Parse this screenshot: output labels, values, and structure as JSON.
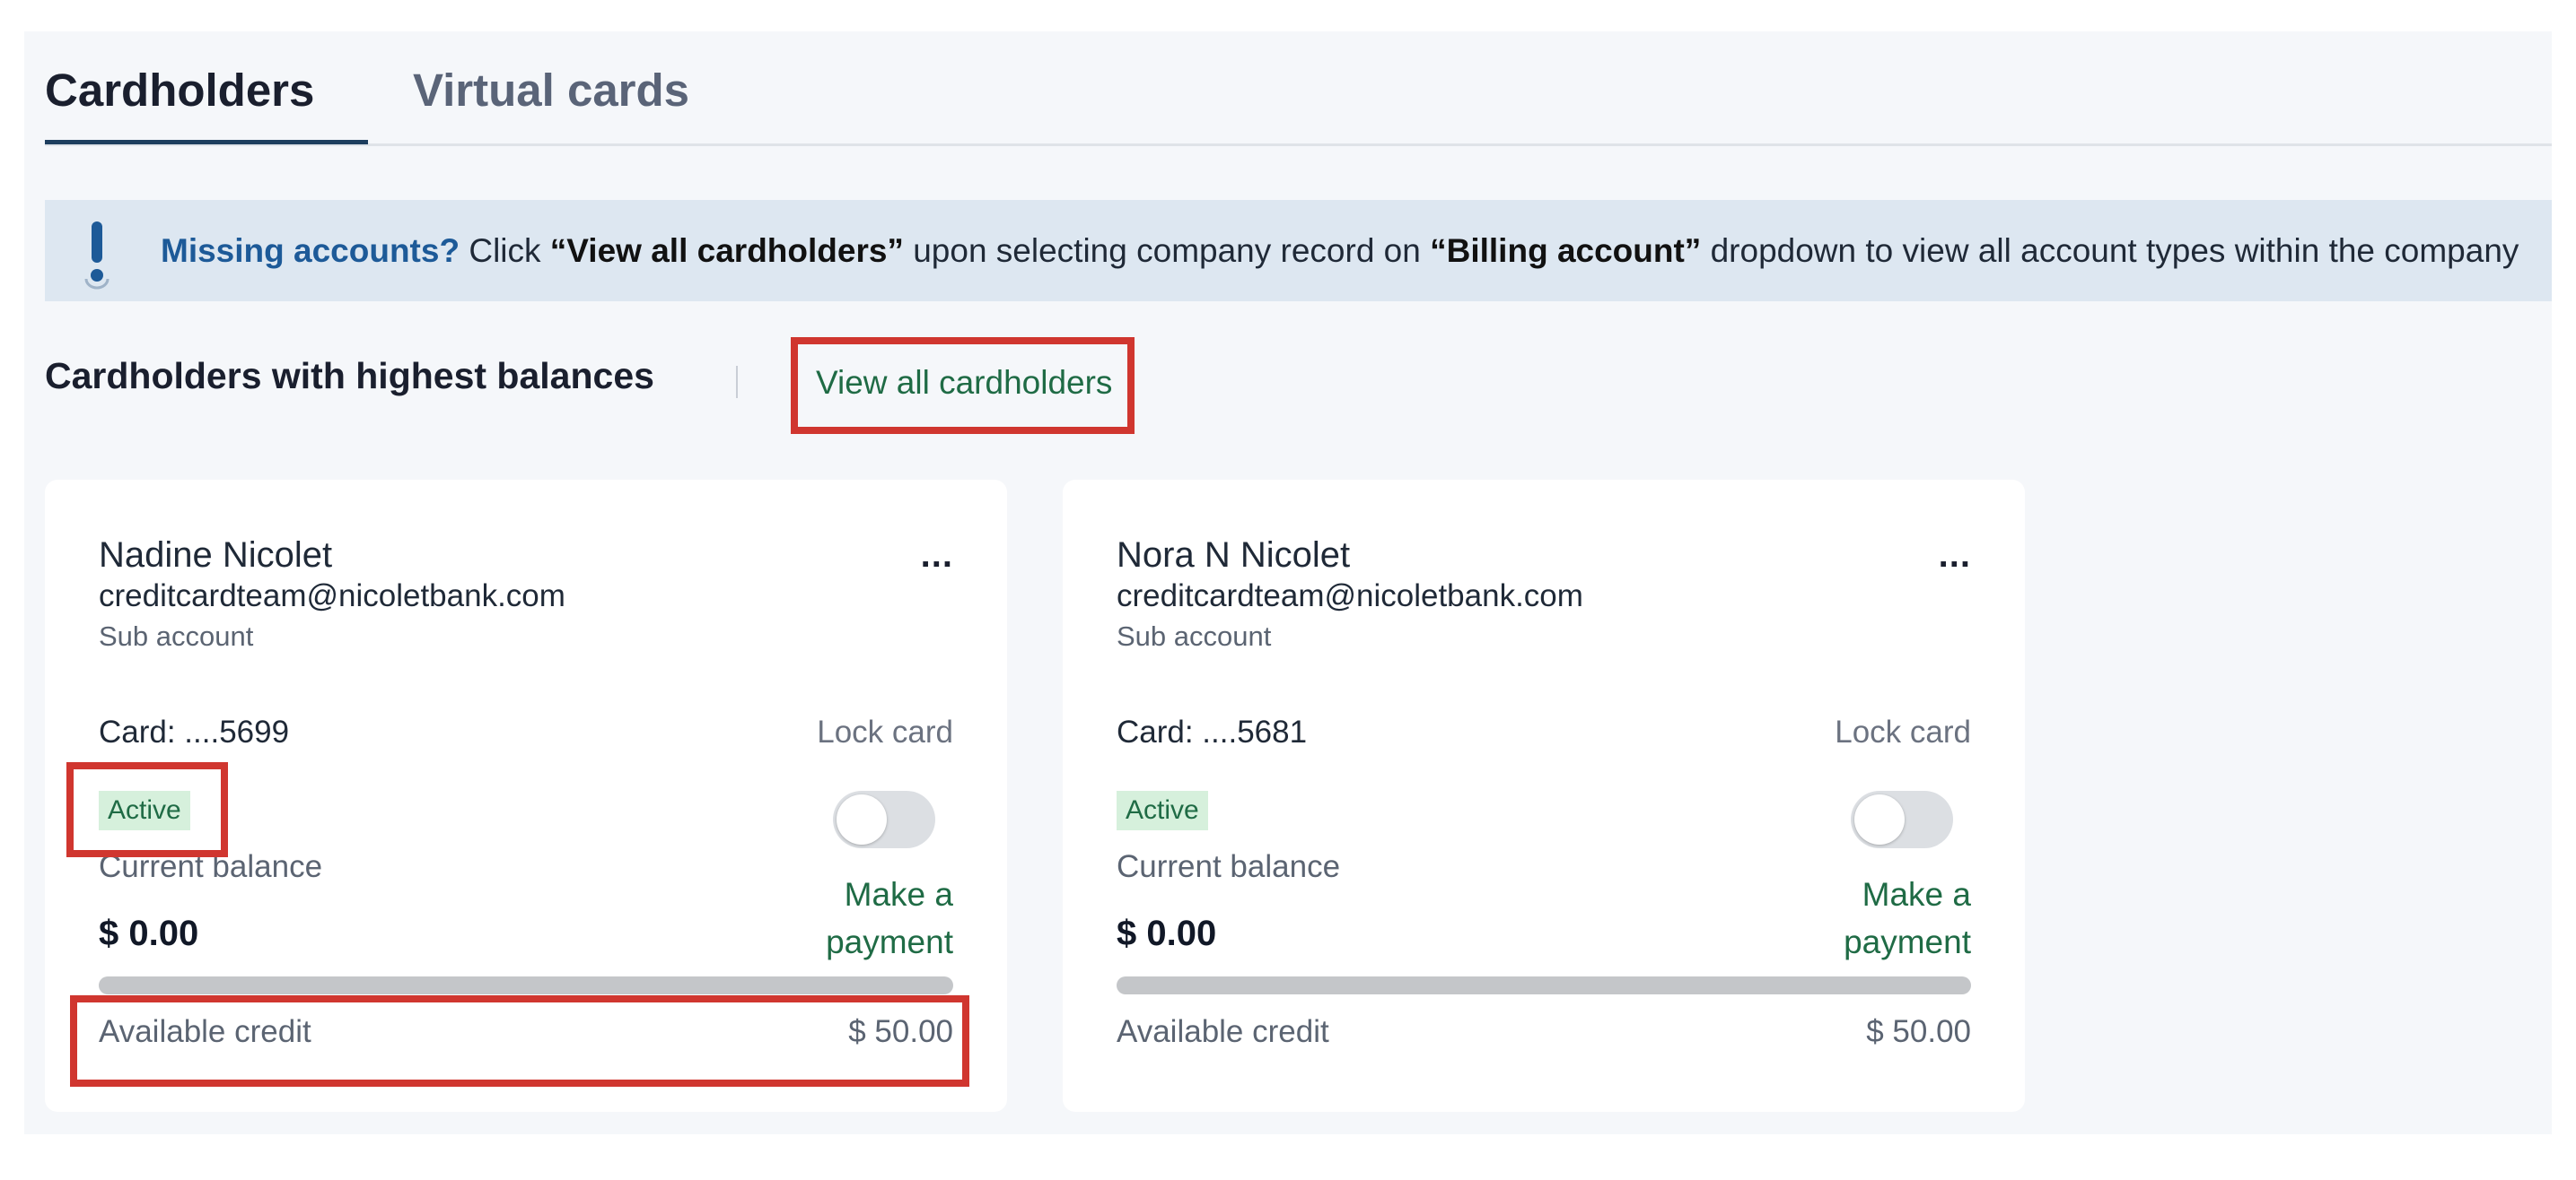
{
  "tabs": [
    {
      "label": "Cardholders",
      "active": true
    },
    {
      "label": "Virtual cards",
      "active": false
    }
  ],
  "banner": {
    "icon": "exclamation-icon",
    "lead": "Missing accounts?",
    "text_1": " Click ",
    "bold_1": "“View all cardholders”",
    "text_2": " upon selecting company record on ",
    "bold_2": "“Billing account”",
    "text_3": " dropdown to view all account types within the company"
  },
  "section": {
    "title": "Cardholders with highest balances",
    "view_all_label": "View all cardholders"
  },
  "cards": [
    {
      "name": "Nadine Nicolet",
      "email": "creditcardteam@nicoletbank.com",
      "account_type": "Sub account",
      "more_label": "...",
      "card_label": "Card: ....5699",
      "lock_label": "Lock card",
      "locked": false,
      "status": "Active",
      "current_balance_label": "Current balance",
      "current_balance": "$ 0.00",
      "make_payment_label": "Make a payment",
      "balance_fraction": 0,
      "available_credit_label": "Available credit",
      "available_credit": "$ 50.00"
    },
    {
      "name": "Nora N Nicolet",
      "email": "creditcardteam@nicoletbank.com",
      "account_type": "Sub account",
      "more_label": "...",
      "card_label": "Card: ....5681",
      "lock_label": "Lock card",
      "locked": false,
      "status": "Active",
      "current_balance_label": "Current balance",
      "current_balance": "$ 0.00",
      "make_payment_label": "Make a payment",
      "balance_fraction": 0,
      "available_credit_label": "Available credit",
      "available_credit": "$ 50.00"
    }
  ],
  "colors": {
    "accent_green": "#1f6b45",
    "highlight_red": "#d0362f",
    "banner_bg": "#dde7f1",
    "tab_underline": "#1d3e5e"
  }
}
